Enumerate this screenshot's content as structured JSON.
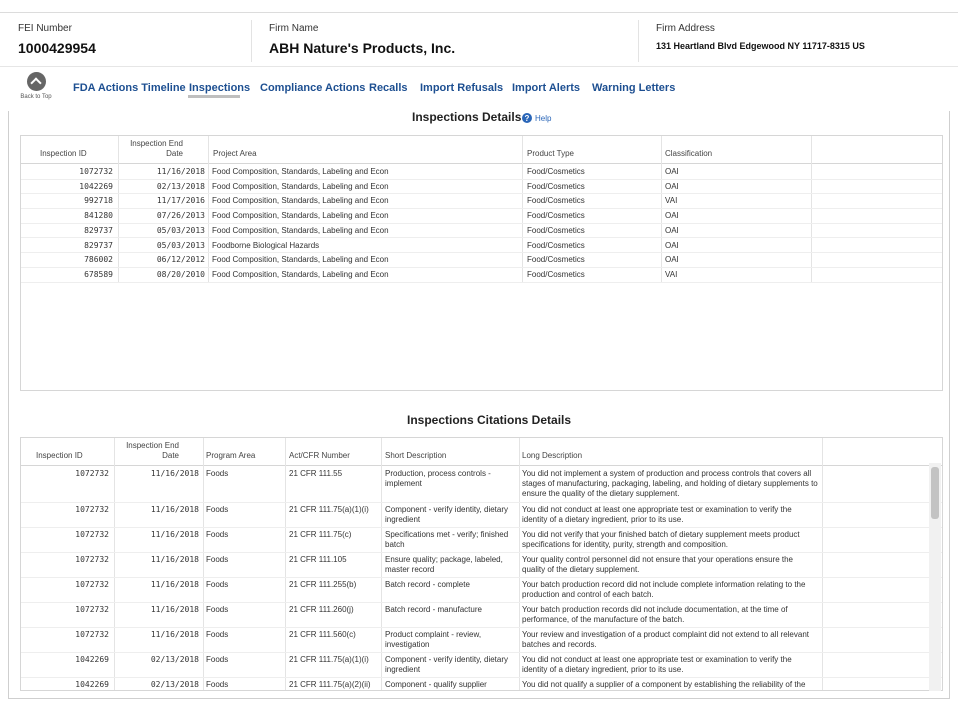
{
  "header": {
    "fei_label": "FEI Number",
    "fei_value": "1000429954",
    "firm_label": "Firm Name",
    "firm_value": "ABH Nature's Products, Inc.",
    "address_label": "Firm Address",
    "address_value": "131 Heartland Blvd Edgewood NY 11717-8315 US"
  },
  "nav": {
    "back_to_top": "Back to Top",
    "back_icon": "chevron-up-icon",
    "tabs": [
      {
        "label": "FDA Actions Timeline"
      },
      {
        "label": "Inspections",
        "active": true
      },
      {
        "label": "Compliance Actions"
      },
      {
        "label": "Recalls"
      },
      {
        "label": "Import Refusals"
      },
      {
        "label": "Import Alerts"
      },
      {
        "label": "Warning Letters"
      }
    ]
  },
  "inspections": {
    "title": "Inspections Details",
    "help_label": "Help",
    "columns": [
      "Inspection ID",
      "Inspection End Date",
      "Project Area",
      "Product Type",
      "Classification"
    ],
    "rows": [
      {
        "id": "1072732",
        "date": "11/16/2018",
        "area": "Food Composition, Standards, Labeling and Econ",
        "type": "Food/Cosmetics",
        "cls": "OAI"
      },
      {
        "id": "1042269",
        "date": "02/13/2018",
        "area": "Food Composition, Standards, Labeling and Econ",
        "type": "Food/Cosmetics",
        "cls": "OAI"
      },
      {
        "id": "992718",
        "date": "11/17/2016",
        "area": "Food Composition, Standards, Labeling and Econ",
        "type": "Food/Cosmetics",
        "cls": "VAI"
      },
      {
        "id": "841280",
        "date": "07/26/2013",
        "area": "Food Composition, Standards, Labeling and Econ",
        "type": "Food/Cosmetics",
        "cls": "OAI"
      },
      {
        "id": "829737",
        "date": "05/03/2013",
        "area": "Food Composition, Standards, Labeling and Econ",
        "type": "Food/Cosmetics",
        "cls": "OAI"
      },
      {
        "id": "829737",
        "date": "05/03/2013",
        "area": "Foodborne Biological Hazards",
        "type": "Food/Cosmetics",
        "cls": "OAI"
      },
      {
        "id": "786002",
        "date": "06/12/2012",
        "area": "Food Composition, Standards, Labeling and Econ",
        "type": "Food/Cosmetics",
        "cls": "OAI"
      },
      {
        "id": "678589",
        "date": "08/20/2010",
        "area": "Food Composition, Standards, Labeling and Econ",
        "type": "Food/Cosmetics",
        "cls": "VAI"
      }
    ]
  },
  "citations": {
    "title": "Inspections Citations Details",
    "columns": [
      "Inspection ID",
      "Inspection End Date",
      "Program Area",
      "Act/CFR Number",
      "Short Description",
      "Long Description"
    ],
    "rows": [
      {
        "id": "1072732",
        "date": "11/16/2018",
        "program": "Foods",
        "cfr": "21 CFR 111.55",
        "short": "Production, process controls - implement",
        "long": "You did not implement a system of production and process controls that covers all stages of manufacturing, packaging, labeling, and holding of dietary supplements to ensure the quality of the dietary supplement."
      },
      {
        "id": "1072732",
        "date": "11/16/2018",
        "program": "Foods",
        "cfr": "21 CFR 111.75(a)(1)(i)",
        "short": "Component - verify identity, dietary ingredient",
        "long": "You did not conduct at least one appropriate test or examination to verify the identity of a dietary ingredient, prior to its use."
      },
      {
        "id": "1072732",
        "date": "11/16/2018",
        "program": "Foods",
        "cfr": "21 CFR 111.75(c)",
        "short": "Specifications met - verify; finished batch",
        "long": "You did not verify that your finished batch of dietary supplement meets product specifications for identity, purity, strength and composition."
      },
      {
        "id": "1072732",
        "date": "11/16/2018",
        "program": "Foods",
        "cfr": "21 CFR 111.105",
        "short": "Ensure quality; package, labeled, master record",
        "long": "Your quality control personnel did not ensure that your operations ensure the quality of the dietary supplement."
      },
      {
        "id": "1072732",
        "date": "11/16/2018",
        "program": "Foods",
        "cfr": "21 CFR 111.255(b)",
        "short": "Batch record - complete",
        "long": "Your batch production record did not include complete information relating to the production and control of each batch."
      },
      {
        "id": "1072732",
        "date": "11/16/2018",
        "program": "Foods",
        "cfr": "21 CFR 111.260(j)",
        "short": "Batch record - manufacture",
        "long": "Your batch production records did not include documentation, at the time of performance, of the manufacture of the batch."
      },
      {
        "id": "1072732",
        "date": "11/16/2018",
        "program": "Foods",
        "cfr": "21 CFR 111.560(c)",
        "short": "Product complaint - review, investigation",
        "long": "Your review and investigation of a product complaint did not extend to all relevant batches and records."
      },
      {
        "id": "1042269",
        "date": "02/13/2018",
        "program": "Foods",
        "cfr": "21 CFR 111.75(a)(1)(i)",
        "short": "Component - verify identity, dietary ingredient",
        "long": "You did not conduct at least one appropriate test or examination to verify the identity of a dietary ingredient, prior to its use."
      },
      {
        "id": "1042269",
        "date": "02/13/2018",
        "program": "Foods",
        "cfr": "21 CFR 111.75(a)(2)(ii)",
        "short": "Component - qualify supplier",
        "long": "You did not qualify a supplier of a component by establishing the reliability of the"
      }
    ]
  }
}
